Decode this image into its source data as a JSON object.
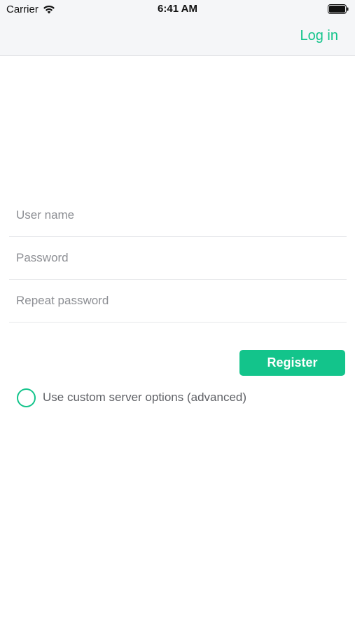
{
  "status_bar": {
    "carrier": "Carrier",
    "time": "6:41 AM"
  },
  "nav": {
    "login_label": "Log in"
  },
  "form": {
    "username_placeholder": "User name",
    "password_placeholder": "Password",
    "repeat_password_placeholder": "Repeat password",
    "register_label": "Register",
    "custom_server_label": "Use custom server options (advanced)",
    "custom_server_checked": false
  },
  "colors": {
    "accent": "#13c48b",
    "nav_background": "#f5f6f8",
    "placeholder": "#8d8f94"
  },
  "icons": [
    "wifi-icon",
    "battery-icon",
    "radio-circle-icon"
  ]
}
